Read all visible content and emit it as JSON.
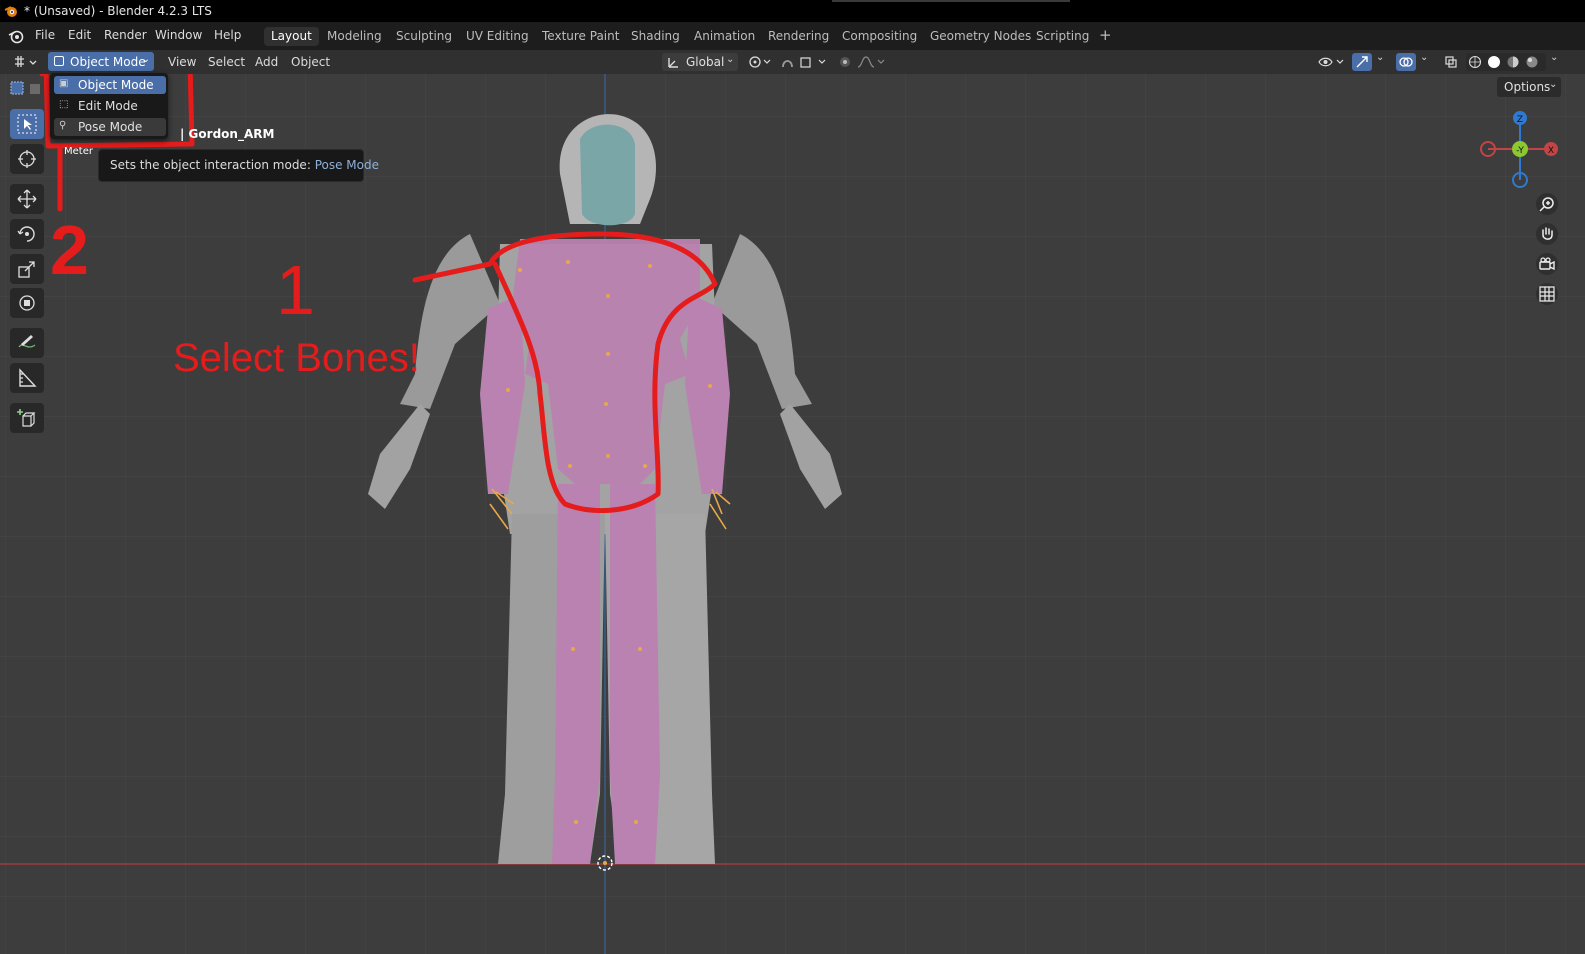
{
  "window": {
    "title": "* (Unsaved) - Blender 4.2.3 LTS",
    "app_icon": "blender-logo-icon"
  },
  "menubar": {
    "items": [
      {
        "label": "File"
      },
      {
        "label": "Edit"
      },
      {
        "label": "Render"
      },
      {
        "label": "Window"
      },
      {
        "label": "Help"
      }
    ],
    "workspaces": [
      {
        "label": "Layout",
        "active": true
      },
      {
        "label": "Modeling"
      },
      {
        "label": "Sculpting"
      },
      {
        "label": "UV Editing"
      },
      {
        "label": "Texture Paint"
      },
      {
        "label": "Shading"
      },
      {
        "label": "Animation"
      },
      {
        "label": "Rendering"
      },
      {
        "label": "Compositing"
      },
      {
        "label": "Geometry Nodes"
      },
      {
        "label": "Scripting"
      }
    ],
    "add_workspace": "+"
  },
  "header": {
    "mode": "Object Mode",
    "menus": [
      {
        "label": "View"
      },
      {
        "label": "Select"
      },
      {
        "label": "Add"
      },
      {
        "label": "Object"
      }
    ],
    "transform_orientation": "Global",
    "icons": [
      "orientation-icon",
      "pivot-icon",
      "snap-icon",
      "proportional-edit-icon",
      "visibility-icon",
      "gizmo-icon",
      "overlay-icon",
      "xray-icon",
      "shading-wireframe-icon",
      "shading-solid-icon",
      "shading-material-icon",
      "shading-rendered-icon"
    ]
  },
  "mode_dropdown": {
    "items": [
      {
        "label": "Object Mode",
        "icon": "object-mode-icon",
        "state": "selected"
      },
      {
        "label": "Edit Mode",
        "icon": "edit-mode-icon",
        "state": "normal"
      },
      {
        "label": "Pose Mode",
        "icon": "pose-mode-icon",
        "state": "hovered"
      }
    ]
  },
  "tooltip": {
    "text": "Sets the object interaction mode:",
    "value": "Pose Mode"
  },
  "viewport": {
    "object_label": "| Gordon_ARM",
    "partial_label": "Meter",
    "options_label": "Options",
    "gizmo": {
      "z": "Z",
      "y": "-Y",
      "x": "X"
    },
    "colors": {
      "bones_pink": "#b982b0",
      "mesh_gray": "#9a9a9a",
      "helmet_teal": "#7aa6a8",
      "x_axis": "#c24444",
      "y_axis": "#8cc830",
      "z_axis": "#2f7ad0",
      "annotation_red": "#e51c1c",
      "accent_blue": "#4a6ea8"
    }
  },
  "toolbar": {
    "tools": [
      {
        "name": "select-box-icon",
        "active": true
      },
      {
        "name": "cursor-icon"
      },
      {
        "name": "move-icon"
      },
      {
        "name": "rotate-icon"
      },
      {
        "name": "scale-icon"
      },
      {
        "name": "transform-icon"
      },
      {
        "name": "annotate-icon"
      },
      {
        "name": "measure-icon"
      },
      {
        "name": "add-cube-icon"
      }
    ]
  },
  "navigation": {
    "buttons": [
      "zoom-icon",
      "pan-hand-icon",
      "camera-icon",
      "grid-view-icon"
    ]
  },
  "annotations": {
    "one": "1",
    "two": "2",
    "text": "Select Bones!"
  }
}
